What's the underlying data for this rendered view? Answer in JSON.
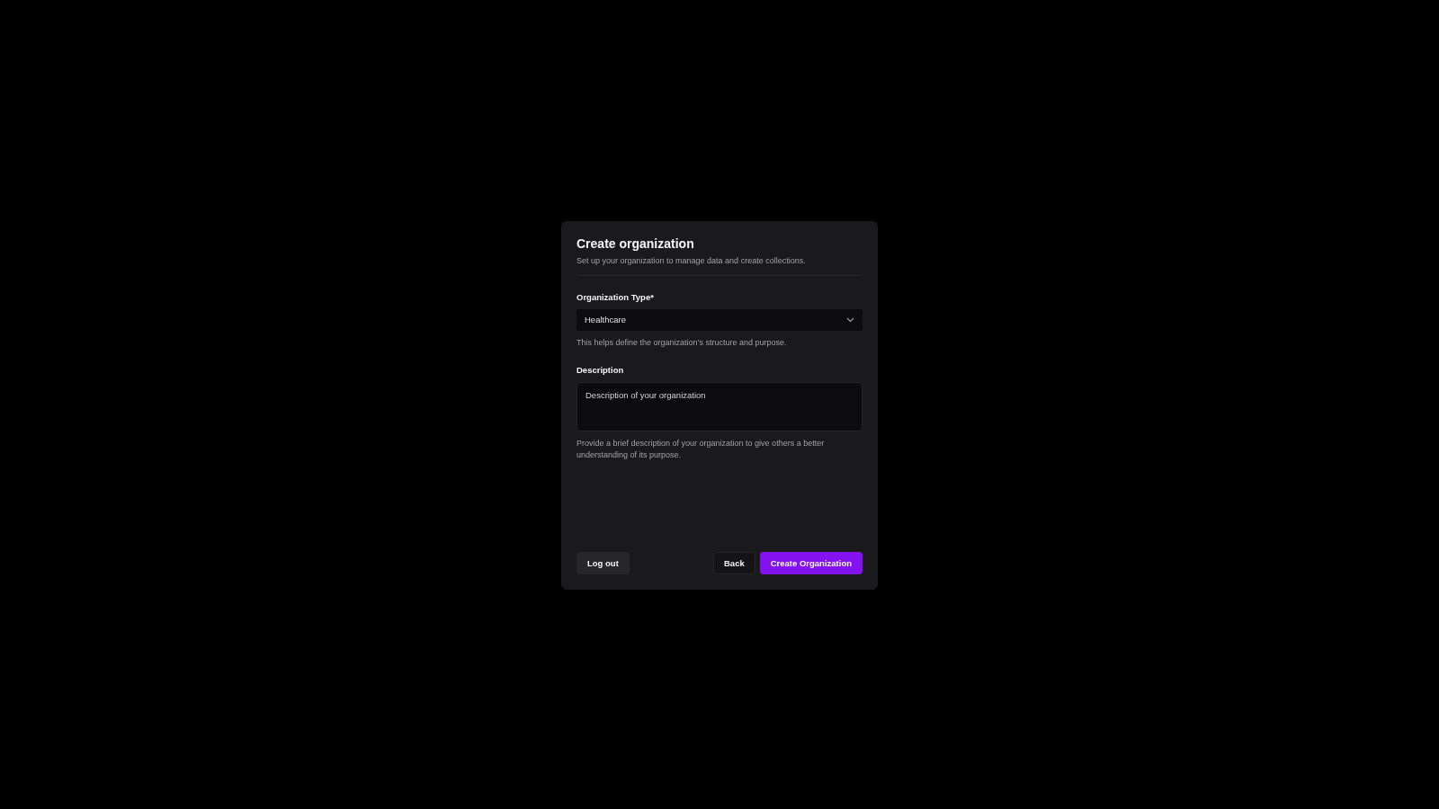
{
  "dialog": {
    "title": "Create organization",
    "subtitle": "Set up your organization to manage data and create collections."
  },
  "fields": [
    {
      "kind": "select",
      "label": "Organization Type*",
      "value": "Healthcare",
      "help": "This helps define the organization’s structure and purpose."
    },
    {
      "kind": "textarea",
      "label": "Description",
      "placeholder": "Description of your organization",
      "help": "Provide a brief description of your organization to give others a better understanding of its purpose."
    }
  ],
  "footer": {
    "left": [
      {
        "label": "Log out",
        "kind": "secondary"
      }
    ],
    "right": [
      {
        "label": "Back",
        "kind": "outline"
      },
      {
        "label": "Create Organization",
        "kind": "primary"
      }
    ]
  }
}
